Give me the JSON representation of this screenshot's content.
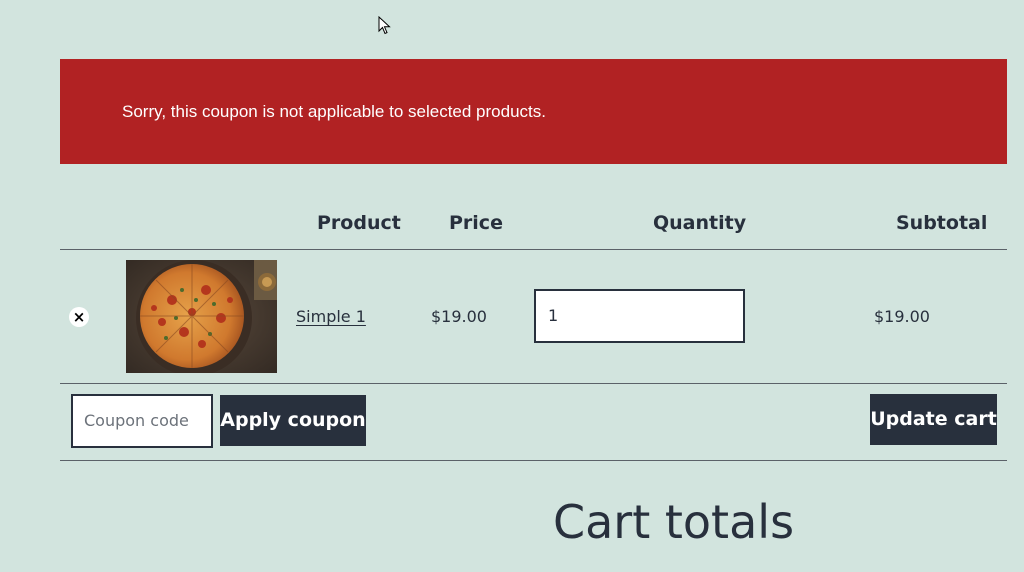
{
  "notice": {
    "message": "Sorry, this coupon is not applicable to selected products."
  },
  "table": {
    "headers": {
      "product": "Product",
      "price": "Price",
      "quantity": "Quantity",
      "subtotal": "Subtotal"
    },
    "rows": [
      {
        "remove_symbol": "×",
        "image": "pizza-thumbnail",
        "name": "Simple 1",
        "price": "$19.00",
        "quantity": "1",
        "subtotal": "$19.00"
      }
    ]
  },
  "coupon": {
    "placeholder": "Coupon code",
    "apply_label": "Apply coupon"
  },
  "actions": {
    "update_label": "Update cart"
  },
  "totals": {
    "heading": "Cart totals"
  },
  "colors": {
    "background": "#d2e4de",
    "error": "#b12223",
    "button": "#28303d"
  }
}
